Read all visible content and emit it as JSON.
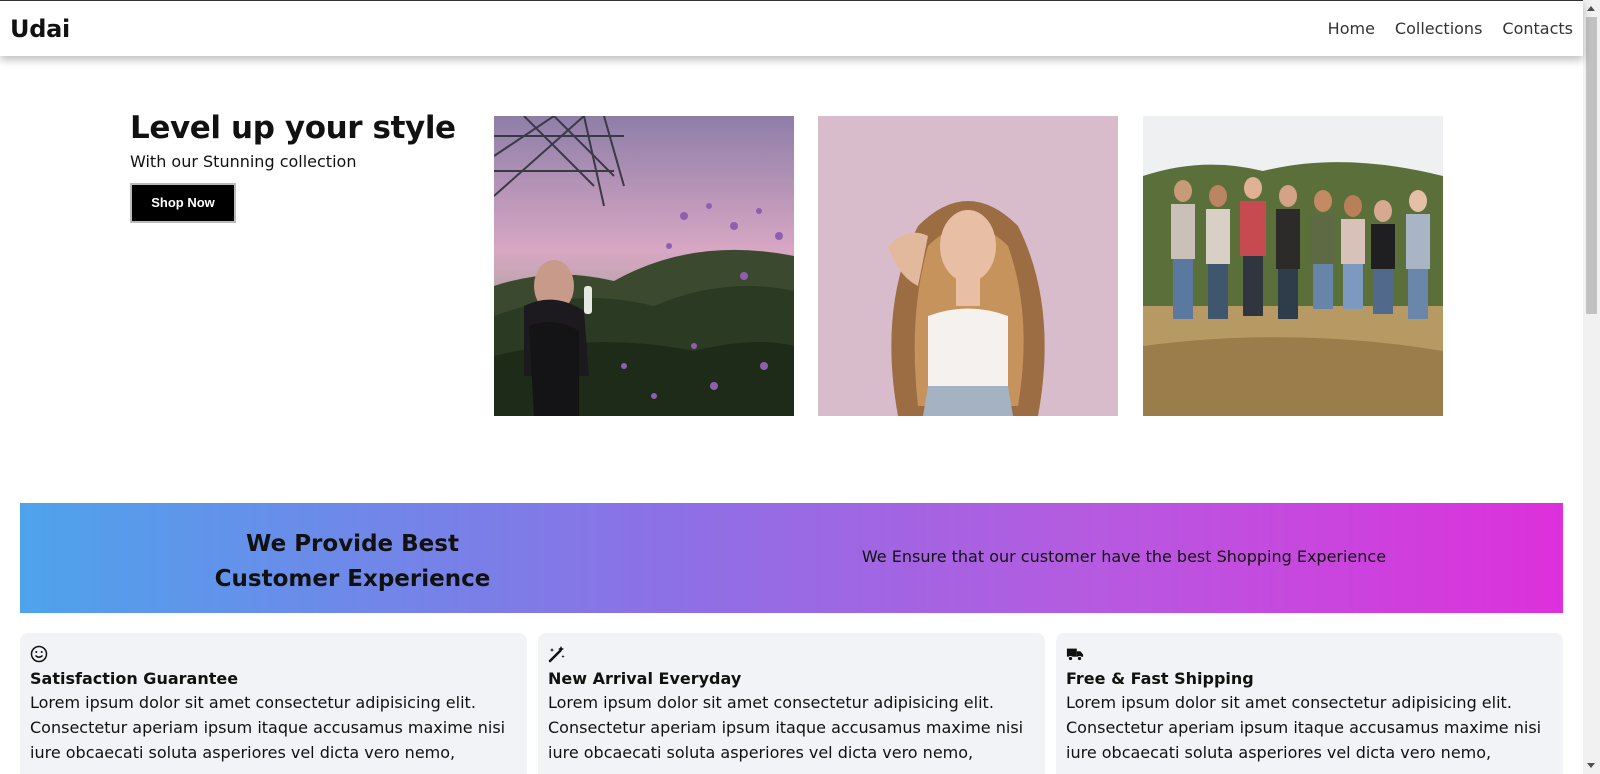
{
  "header": {
    "brand": "Udai",
    "nav": [
      {
        "label": "Home"
      },
      {
        "label": "Collections"
      },
      {
        "label": "Contacts"
      }
    ]
  },
  "hero": {
    "title": "Level up your style",
    "subtitle": "With our Stunning collection",
    "button_label": "Shop Now"
  },
  "banner": {
    "title_line1": "We Provide Best",
    "title_line2": "Customer Experience",
    "text": "We Ensure that our customer have the best Shopping Experience"
  },
  "features": [
    {
      "icon": "smile-icon",
      "title": "Satisfaction Guarantee",
      "text": "Lorem ipsum dolor sit amet consectetur adipisicing elit. Consectetur aperiam ipsum itaque accusamus maxime nisi iure obcaecati soluta asperiores vel dicta vero nemo,"
    },
    {
      "icon": "magic-wand-icon",
      "title": "New Arrival Everyday",
      "text": "Lorem ipsum dolor sit amet consectetur adipisicing elit. Consectetur aperiam ipsum itaque accusamus maxime nisi iure obcaecati soluta asperiores vel dicta vero nemo,"
    },
    {
      "icon": "truck-icon",
      "title": "Free & Fast Shipping",
      "text": "Lorem ipsum dolor sit amet consectetur adipisicing elit. Consectetur aperiam ipsum itaque accusamus maxime nisi iure obcaecati soluta asperiores vel dicta vero nemo,"
    }
  ],
  "colors": {
    "banner_gradient_start": "#4ea3ec",
    "banner_gradient_end": "#dd30dc",
    "button_bg": "#000000",
    "card_bg": "#f2f3f6"
  }
}
